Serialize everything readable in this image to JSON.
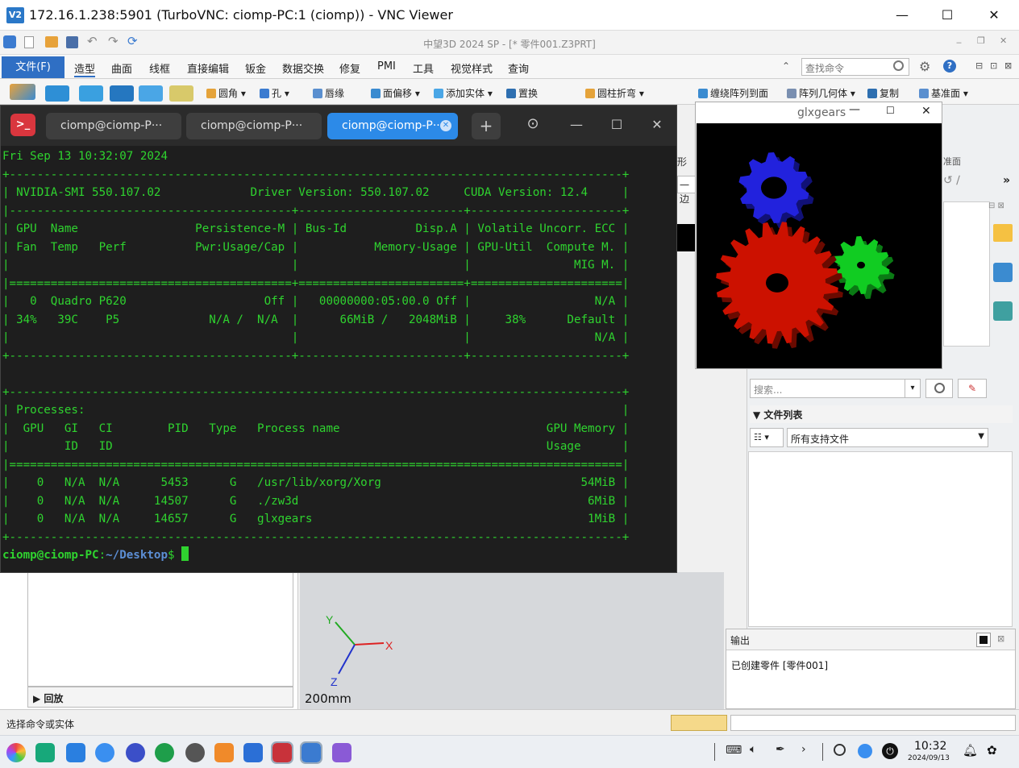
{
  "vnc": {
    "title": "172.16.1.238:5901 (TurboVNC: ciomp-PC:1 (ciomp)) - VNC Viewer",
    "logo": "V2",
    "minimize": "—",
    "maximize": "☐",
    "close": "✕"
  },
  "zw3d": {
    "document_title": "中望3D 2024 SP - [* 零件001.Z3PRT]",
    "menu": [
      "文件(F)",
      "造型",
      "曲面",
      "线框",
      "直接编辑",
      "钣金",
      "数据交换",
      "修复",
      "PMI",
      "工具",
      "视觉样式",
      "查询"
    ],
    "find_placeholder": "查找命令",
    "ribbon": [
      "圆角",
      "孔",
      "唇缘",
      "面偏移",
      "添加实体",
      "置换",
      "圆柱折弯",
      "缠绕阵列到面",
      "阵列几何体",
      "复制",
      "基准面"
    ],
    "side_labels": {
      "shape": "形",
      "one": "一边",
      "datum": "准面"
    },
    "search_placeholder": "搜索...",
    "files_title": "文件列表",
    "files_filter": "所有支持文件",
    "replay": "回放",
    "axis": {
      "x": "X",
      "y": "Y",
      "z": "Z"
    },
    "scale": "200mm",
    "output": {
      "title": "输出",
      "message": "已创建零件 [零件001]"
    },
    "status": "选择命令或实体"
  },
  "terminal": {
    "tabs": [
      "ciomp@ciomp-P···",
      "ciomp@ciomp-P···",
      "ciomp@ciomp-P··"
    ],
    "lines": [
      "Fri Sep 13 10:32:07 2024",
      "+-----------------------------------------------------------------------------------------+",
      "| NVIDIA-SMI 550.107.02             Driver Version: 550.107.02     CUDA Version: 12.4     |",
      "|-----------------------------------------+------------------------+----------------------+",
      "| GPU  Name                 Persistence-M | Bus-Id          Disp.A | Volatile Uncorr. ECC |",
      "| Fan  Temp   Perf          Pwr:Usage/Cap |           Memory-Usage | GPU-Util  Compute M. |",
      "|                                         |                        |               MIG M. |",
      "|=========================================+========================+======================|",
      "|   0  Quadro P620                    Off |   00000000:05:00.0 Off |                  N/A |",
      "| 34%   39C    P5             N/A /  N/A  |      66MiB /   2048MiB |     38%      Default |",
      "|                                         |                        |                  N/A |",
      "+-----------------------------------------+------------------------+----------------------+",
      "",
      "+-----------------------------------------------------------------------------------------+",
      "| Processes:                                                                              |",
      "|  GPU   GI   CI        PID   Type   Process name                              GPU Memory |",
      "|        ID   ID                                                               Usage      |",
      "|=========================================================================================|",
      "|    0   N/A  N/A      5453      G   /usr/lib/xorg/Xorg                             54MiB |",
      "|    0   N/A  N/A     14507      G   ./zw3d                                          6MiB |",
      "|    0   N/A  N/A     14657      G   glxgears                                        1MiB |",
      "+-----------------------------------------------------------------------------------------+"
    ],
    "prompt_user": "ciomp@ciomp-PC",
    "prompt_sep": ":",
    "prompt_path": "~/Desktop",
    "prompt_end": "$ "
  },
  "glxgears": {
    "title": "glxgears"
  },
  "taskbar": {
    "time": "10:32",
    "date": "2024/09/13"
  },
  "colors": {
    "accent": "#2f6fc4",
    "terminal_green": "#2fd32f",
    "terminal_bg": "#1e1e1e",
    "gear_red": "#cc1100",
    "gear_green": "#11cc22",
    "gear_blue": "#2222dd"
  }
}
